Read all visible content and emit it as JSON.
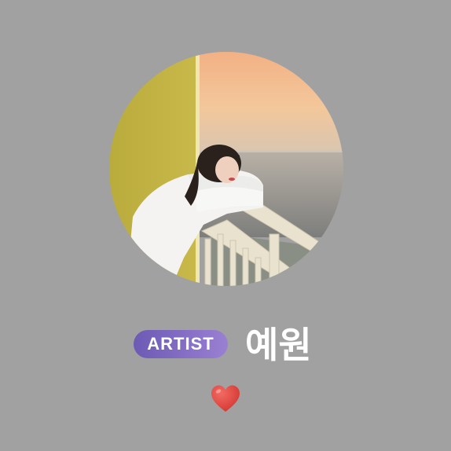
{
  "profile": {
    "badge_label": "ARTIST",
    "name": "예원",
    "photo_icon": "profile-photo",
    "reaction_icon": "red-heart-emoji"
  },
  "colors": {
    "background": "#a1a1a1",
    "badge_gradient_start": "#6c5ab4",
    "badge_gradient_end": "#9a80d2",
    "name_text": "#ffffff",
    "heart": "#e0443e"
  }
}
